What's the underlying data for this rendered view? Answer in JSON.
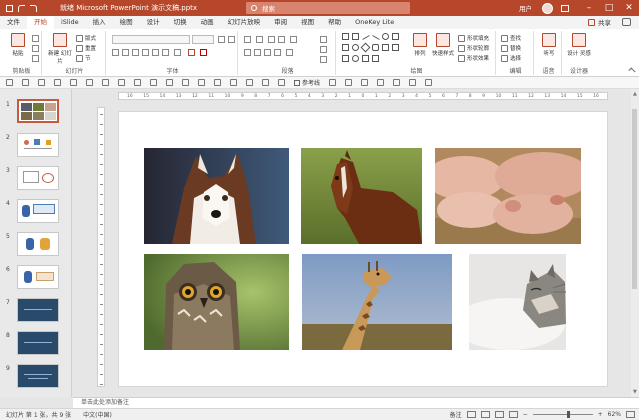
{
  "titlebar": {
    "title": "就绪  Microsoft PowerPoint 演示文稿.pptx",
    "search_placeholder": "搜索",
    "user": "用户",
    "min": "–",
    "max": "□",
    "close": "✕",
    "accent": "#b7472a"
  },
  "tabs": [
    {
      "label": "文件"
    },
    {
      "label": "开始",
      "active": true
    },
    {
      "label": "iSlide"
    },
    {
      "label": "插入"
    },
    {
      "label": "绘图"
    },
    {
      "label": "设计"
    },
    {
      "label": "切换"
    },
    {
      "label": "动画"
    },
    {
      "label": "幻灯片放映"
    },
    {
      "label": "审阅"
    },
    {
      "label": "视图"
    },
    {
      "label": "帮助"
    },
    {
      "label": "OneKey Lite"
    }
  ],
  "share_label": "共享",
  "ribbon": {
    "clipboard": {
      "label": "剪贴板",
      "paste": "粘贴"
    },
    "slides": {
      "label": "幻灯片",
      "new_slide": "新建\n幻灯片",
      "layout": "版式",
      "reset": "重置",
      "section": "节"
    },
    "font": {
      "label": "字体"
    },
    "paragraph": {
      "label": "段落"
    },
    "drawing": {
      "label": "绘图",
      "arrange": "排列",
      "quick_styles": "快速样式",
      "fill": "形状填充",
      "outline": "形状轮廓",
      "effects": "形状效果"
    },
    "editing": {
      "label": "编辑",
      "find": "查找",
      "replace": "替换",
      "select": "选择"
    },
    "voice": {
      "label": "语音",
      "dictate": "听写"
    },
    "designer": {
      "label": "设计器",
      "design_ideas": "设计\n灵感"
    }
  },
  "toolbar2": {
    "checkbox_label": "参考线"
  },
  "ruler": {
    "ticks": [
      "16",
      "15",
      "14",
      "13",
      "12",
      "11",
      "10",
      "9",
      "8",
      "7",
      "6",
      "5",
      "4",
      "3",
      "2",
      "1",
      "0",
      "1",
      "2",
      "3",
      "4",
      "5",
      "6",
      "7",
      "8",
      "9",
      "10",
      "11",
      "12",
      "13",
      "14",
      "15",
      "16"
    ]
  },
  "slides_panel": {
    "numbers": [
      "1",
      "2",
      "3",
      "4",
      "5",
      "6",
      "7",
      "8",
      "9"
    ],
    "selected": 1
  },
  "photos": [
    "husky-dog",
    "brown-horse",
    "sleeping-pigs",
    "owl",
    "giraffe",
    "cat-on-pillow"
  ],
  "notes_placeholder": "单击此处添加备注",
  "status": {
    "slide_info": "幻灯片 第 1 张，共 9 张",
    "language": "中文(中国)",
    "notes": "备注",
    "zoom": "62%"
  }
}
